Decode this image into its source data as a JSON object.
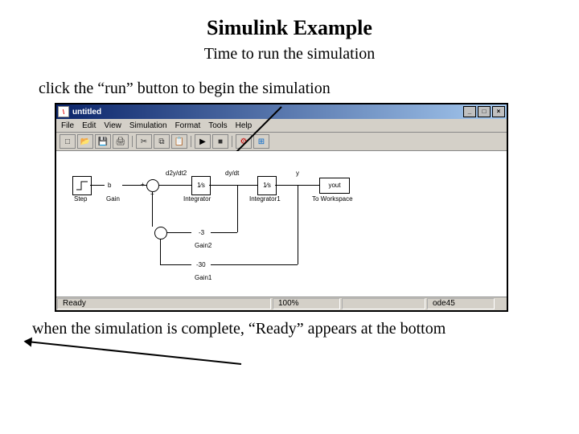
{
  "slide": {
    "title": "Simulink Example",
    "subtitle": "Time to run the simulation",
    "caption_above": "click the “run” button to begin the simulation",
    "caption_below": "when the simulation is complete, “Ready” appears at the bottom"
  },
  "window": {
    "title": "untitled",
    "win_buttons": {
      "min": "_",
      "max": "□",
      "close": "×"
    }
  },
  "menubar": {
    "file": "File",
    "edit": "Edit",
    "view": "View",
    "simulation": "Simulation",
    "format": "Format",
    "tools": "Tools",
    "help": "Help"
  },
  "toolbar": {
    "new": "□",
    "open": "📂",
    "save": "💾",
    "print": "🖨",
    "cut": "✂",
    "copy": "⧉",
    "paste": "📋",
    "run": "▶",
    "stop": "■",
    "build": "⚙",
    "lib": "⊞"
  },
  "statusbar": {
    "ready": "Ready",
    "zoom": "100%",
    "solver": "ode45"
  },
  "diagram": {
    "step_label": "Step",
    "gain_label": "Gain",
    "d2y": "d2y/dt2",
    "int1": "1⁄s",
    "int1_label": "Integrator",
    "dy": "dy/dt",
    "int2": "1⁄s",
    "int2_label": "Integrator1",
    "y": "y",
    "ws": "yout",
    "ws_label": "To Workspace",
    "gain2_val": "-3",
    "gain2_label": "Gain2",
    "gain1_val": "-30",
    "gain1_label": "Gain1",
    "sum_plus1": "+",
    "sum_plus2": "+",
    "b_val": "b"
  }
}
